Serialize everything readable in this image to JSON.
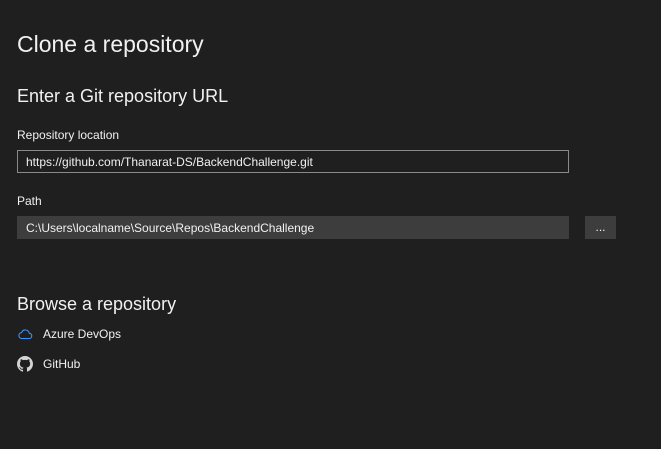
{
  "page": {
    "title": "Clone a repository"
  },
  "git_url_section": {
    "title": "Enter a Git repository URL",
    "repository_location": {
      "label": "Repository location",
      "value": "https://github.com/Thanarat-DS/BackendChallenge.git"
    },
    "path": {
      "label": "Path",
      "value": "C:\\Users\\localname\\Source\\Repos\\BackendChallenge",
      "browse_label": "..."
    }
  },
  "browse_section": {
    "title": "Browse a repository",
    "providers": [
      {
        "label": "Azure DevOps",
        "icon": "cloud-icon"
      },
      {
        "label": "GitHub",
        "icon": "github-icon"
      }
    ]
  },
  "colors": {
    "background": "#1f1f1f",
    "text": "#f1f1f1",
    "input_border": "#8a8a8a",
    "input_fill": "#3d3d3d",
    "azure_icon": "#3794ff"
  }
}
